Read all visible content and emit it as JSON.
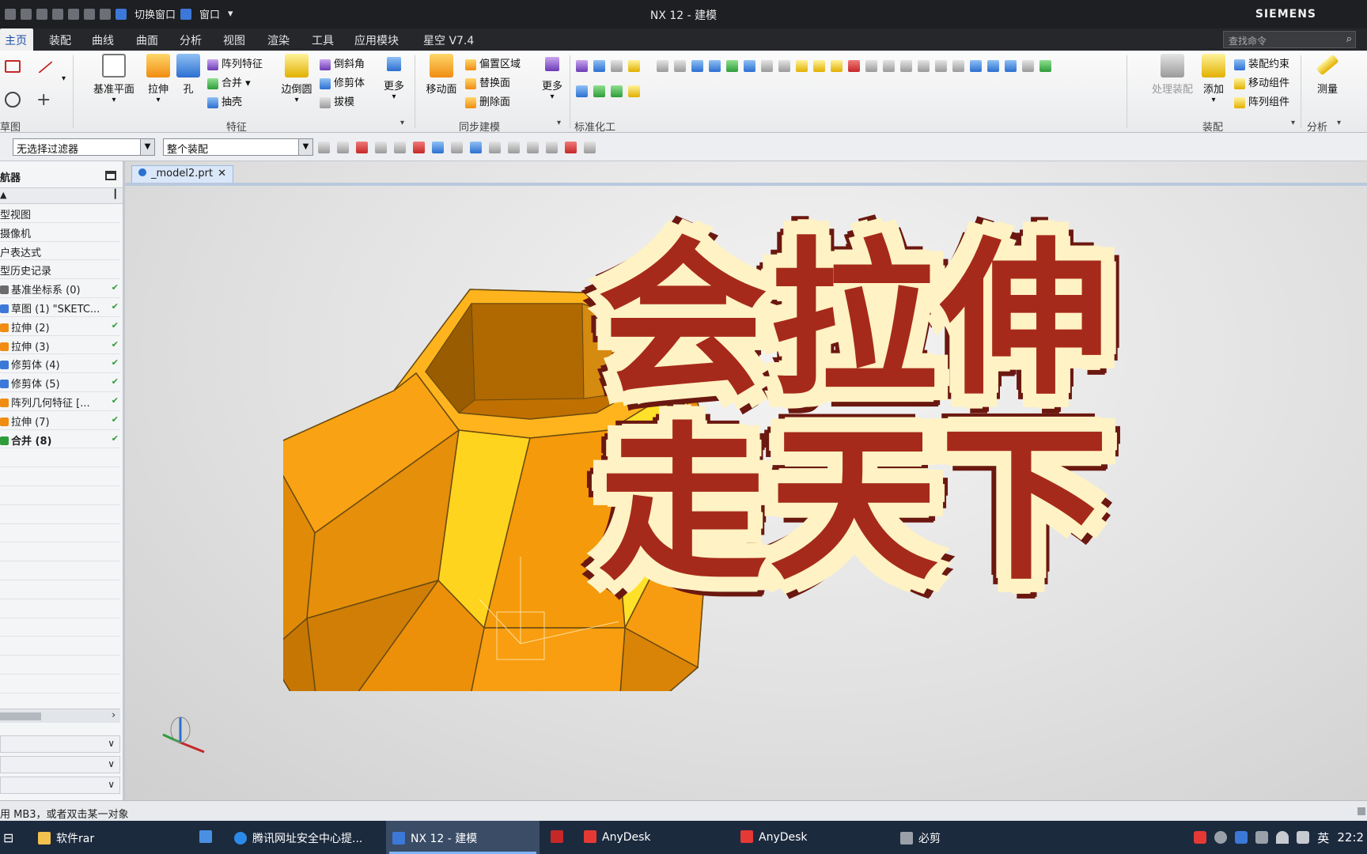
{
  "titlebar": {
    "switch_window": "切换窗口",
    "window_menu": "窗口",
    "title": "NX 12 - 建模",
    "brand": "SIEMENS"
  },
  "tabs": [
    {
      "label": "主页",
      "active": true
    },
    {
      "label": "装配"
    },
    {
      "label": "曲线"
    },
    {
      "label": "曲面"
    },
    {
      "label": "分析"
    },
    {
      "label": "视图"
    },
    {
      "label": "渲染"
    },
    {
      "label": "工具"
    },
    {
      "label": "应用模块"
    },
    {
      "label": "星空 V7.4"
    }
  ],
  "command_search": {
    "placeholder": "查找命令"
  },
  "ribbon": {
    "direct_sketch_label": "草图",
    "datum_plane": "基准平面",
    "extrude": "拉伸",
    "hole": "孔",
    "pattern_feature": "阵列特征",
    "unite": "合并",
    "shell": "抽壳",
    "edge_blend": "边倒圆",
    "chamfer": "倒斜角",
    "trim_body": "修剪体",
    "draft": "拔模",
    "more1": "更多",
    "feature_group": "特征",
    "move_face": "移动面",
    "offset_region": "偏置区域",
    "replace_face": "替换面",
    "delete_face": "删除面",
    "more2": "更多",
    "sync_group": "同步建模",
    "standardize_group": "标准化工",
    "assembly_constraint": "装配约束",
    "move_component": "移动组件",
    "pattern_component": "阵列组件",
    "add": "添加",
    "process_assembly": "处理装配",
    "assembly_group": "装配",
    "measure": "测量",
    "analysis_group": "分析"
  },
  "selection_bar": {
    "filter": "无选择过滤器",
    "scope": "整个装配"
  },
  "navigator": {
    "title": "航器",
    "items": [
      {
        "label": "型视图"
      },
      {
        "label": "摄像机"
      },
      {
        "label": "户表达式"
      },
      {
        "label": "型历史记录"
      },
      {
        "label": "基准坐标系 (0)",
        "icon_color": "#6b6b6b",
        "check": "✔"
      },
      {
        "label": "草图 (1) \"SKETC...",
        "icon_color": "#3c78d8",
        "check": "✔"
      },
      {
        "label": "拉伸 (2)",
        "icon_color": "#f08c12",
        "check": "✔"
      },
      {
        "label": "拉伸 (3)",
        "icon_color": "#f08c12",
        "check": "✔"
      },
      {
        "label": "修剪体 (4)",
        "icon_color": "#3c78d8",
        "check": "✔"
      },
      {
        "label": "修剪体 (5)",
        "icon_color": "#3c78d8",
        "check": "✔"
      },
      {
        "label": "阵列几何特征 [...",
        "icon_color": "#f08c12",
        "check": "✔"
      },
      {
        "label": "拉伸 (7)",
        "icon_color": "#f08c12",
        "check": "✔"
      },
      {
        "label": "合并 (8)",
        "icon_color": "#2e9c3a",
        "check": "✔",
        "bold": true
      }
    ]
  },
  "document_tab": "_model2.prt",
  "caption": {
    "line1": "会拉伸",
    "line2": "走天下"
  },
  "status_text": "用 MB3，或者双击某一对象",
  "taskbar": {
    "items": [
      {
        "label": "软件rar",
        "icon_color": "#f2c14e"
      },
      {
        "label": "",
        "icon_color": "#4a90e2"
      },
      {
        "label": "腾讯网址安全中心提...",
        "icon_color": "#2c8be8"
      },
      {
        "label": "NX 12 - 建模",
        "icon_color": "#3c78d8",
        "active": true
      },
      {
        "label": "",
        "icon_color": "#c62828"
      },
      {
        "label": "AnyDesk",
        "icon_color": "#e53935"
      },
      {
        "label": "AnyDesk",
        "icon_color": "#e53935"
      },
      {
        "label": "必剪",
        "icon_color": "#9aa0a8"
      }
    ],
    "tray": {
      "ime": "英",
      "time": "22:2"
    }
  },
  "colors": {
    "model_light": "#ffb41e",
    "model_mid": "#f59a0a",
    "model_dark": "#c87800",
    "model_yellow": "#ffe12a",
    "caption_red": "#a62a1b",
    "caption_cream": "#fff2c4"
  }
}
